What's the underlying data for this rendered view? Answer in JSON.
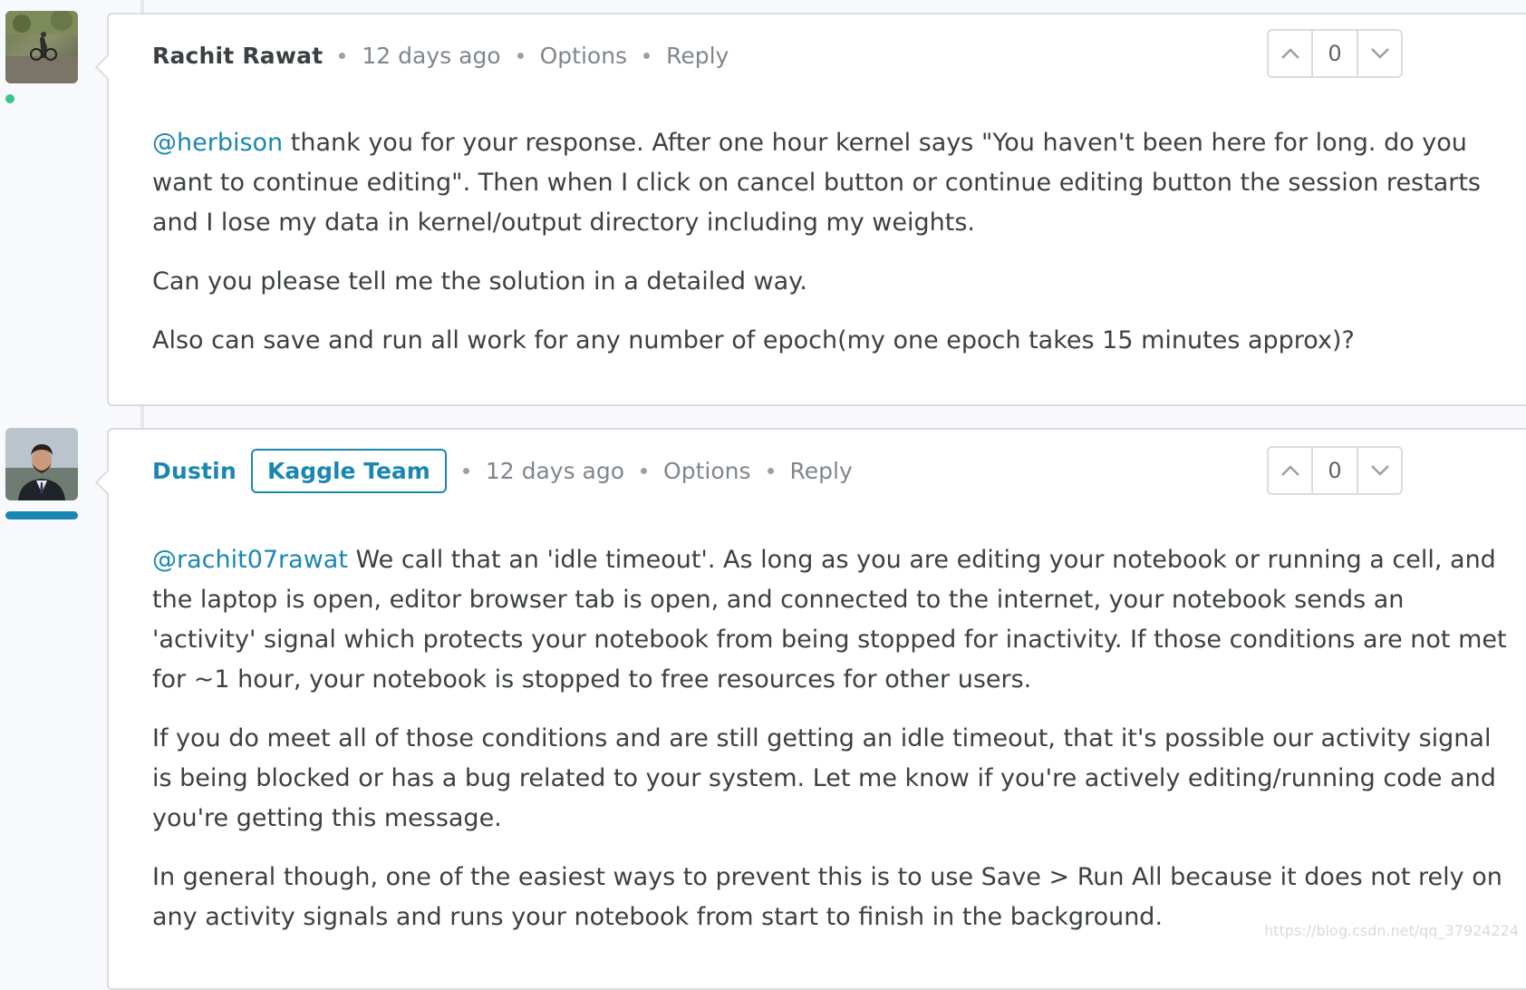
{
  "comments": [
    {
      "author": "Rachit Rawat",
      "time": "12 days ago",
      "options_label": "Options",
      "reply_label": "Reply",
      "votes": "0",
      "paragraphs": [
        {
          "mention": "@herbison",
          "text": " thank you for your response. After one hour kernel says \"You haven't been here for long. do you want to continue editing\". Then when I click on cancel button or continue editing button the session restarts and I lose my data in kernel/output directory including my weights."
        },
        {
          "mention": "",
          "text": "Can you please tell me the solution in a detailed way."
        },
        {
          "mention": "",
          "text": "Also can save and run all work for any number of epoch(my one epoch takes 15 minutes approx)?"
        }
      ]
    },
    {
      "author": "Dustin",
      "badge": "Kaggle Team",
      "time": "12 days ago",
      "options_label": "Options",
      "reply_label": "Reply",
      "votes": "0",
      "paragraphs": [
        {
          "mention": "@rachit07rawat",
          "text": " We call that an 'idle timeout'. As long as you are editing your notebook or running a cell, and the laptop is open, editor browser tab is open, and connected to the internet, your notebook sends an 'activity' signal which protects your notebook from being stopped for inactivity. If those conditions are not met for ~1 hour, your notebook is stopped to free resources for other users."
        },
        {
          "mention": "",
          "text": "If you do meet all of those conditions and are still getting an idle timeout, that it's possible our activity signal is being blocked or has a bug related to your system. Let me know if you're actively editing/running code and you're getting this message."
        },
        {
          "mention": "",
          "text": "In general though, one of the easiest ways to prevent this is to use Save > Run All because it does not rely on any activity signals and runs your notebook from start to finish in the background."
        }
      ]
    }
  ],
  "watermark": "https://blog.csdn.net/qq_37924224",
  "colors": {
    "link": "#1a87b3",
    "online": "#3ac48e",
    "border": "#dadce0"
  },
  "icons": {
    "upvote": "chevron-up-icon",
    "downvote": "chevron-down-icon"
  }
}
